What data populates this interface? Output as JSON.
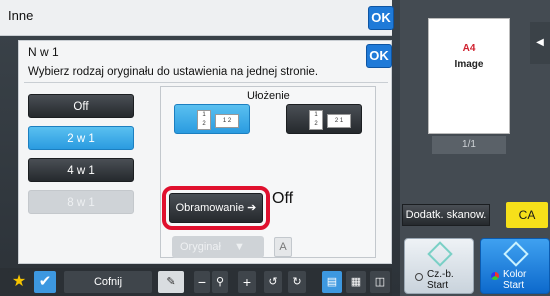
{
  "header": {
    "title": "Inne",
    "ok_label": "OK"
  },
  "dialog": {
    "title": "N w 1",
    "ok_label": "OK",
    "description": "Wybierz rodzaj oryginału do ustawienia na jednej stronie.",
    "options": [
      "Off",
      "2 w 1",
      "4 w 1",
      "8 w 1"
    ],
    "selected_option": "2 w 1",
    "layout_label": "Ułożenie",
    "layout_icons": [
      {
        "digits": "1 2",
        "icon": "layout-2in1-left-right-icon"
      },
      {
        "digits": "2 1",
        "icon": "layout-2in1-right-left-icon"
      }
    ],
    "border_button_label": "Obramowanie",
    "border_value": "Off",
    "original_button_label": "Oryginał",
    "a_button_label": "A"
  },
  "bottom": {
    "back_label": "Cofnij"
  },
  "right": {
    "preview_size": "A4",
    "preview_text": "Image",
    "page_indicator": "1/1",
    "scan_more_label": "Dodatk. skanow.",
    "ca_label": "CA",
    "start_bw_label": [
      "Cz.-b.",
      "Start"
    ],
    "start_color_label": [
      "Kolor",
      "Start"
    ]
  },
  "colors": {
    "accent": "#1f7ad8",
    "highlight": "#e0102e",
    "ca": "#f6e01a"
  }
}
